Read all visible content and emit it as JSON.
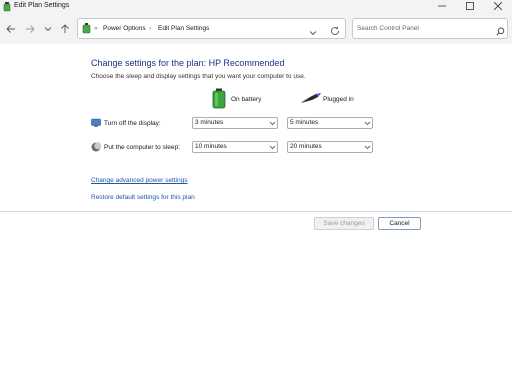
{
  "window": {
    "title": "Edit Plan Settings",
    "icon": "power-plan-icon",
    "minimize_icon": "minimize-icon",
    "maximize_icon": "maximize-icon",
    "close_icon": "close-icon"
  },
  "nav": {
    "back_icon": "arrow-left-icon",
    "forward_icon": "arrow-right-icon",
    "recent_icon": "chevron-down-icon",
    "up_icon": "arrow-up-icon",
    "breadcrumb": {
      "separator": "»",
      "items": [
        "Power Options",
        "Edit Plan Settings"
      ],
      "arrow": "›"
    },
    "refresh_icon": "refresh-icon",
    "search": {
      "placeholder": "Search Control Panel",
      "icon": "search-icon"
    }
  },
  "content": {
    "heading": "Change settings for the plan: HP Recommended",
    "subtitle": "Choose the sleep and display settings that you want your computer to use.",
    "columns": {
      "on_battery": "On battery",
      "plugged_in": "Plugged in"
    },
    "rows": [
      {
        "label": "Turn off the display:",
        "icon": "display-icon",
        "battery": "3 minutes",
        "plugged": "5 minutes"
      },
      {
        "label": "Put the computer to sleep:",
        "icon": "sleep-moon-icon",
        "battery": "10 minutes",
        "plugged": "20 minutes"
      }
    ],
    "links": {
      "advanced": "Change advanced power settings",
      "restore": "Restore default settings for this plan"
    }
  },
  "footer": {
    "save_label": "Save changes",
    "cancel_label": "Cancel"
  },
  "colors": {
    "heading": "#1e3287",
    "link": "#1f57a6",
    "battery": "#3aa53a"
  }
}
